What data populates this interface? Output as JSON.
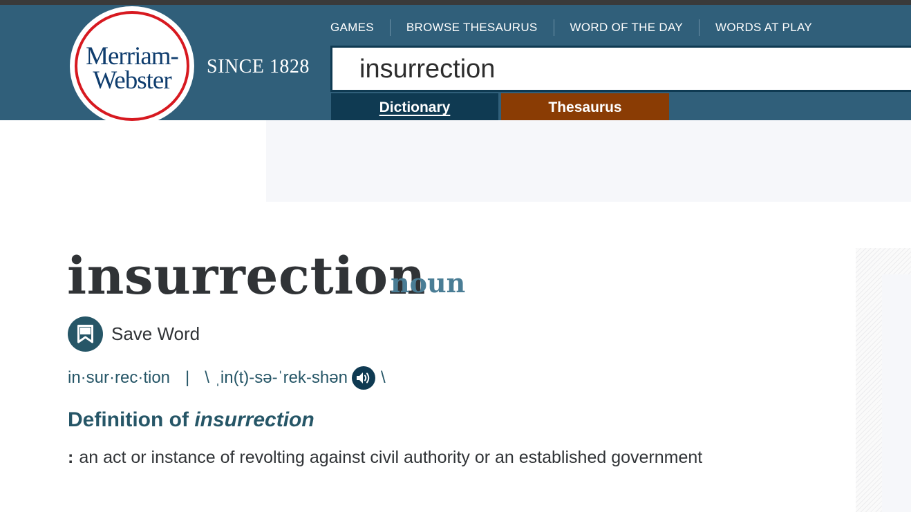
{
  "logo": {
    "line1": "Merriam-",
    "line2": "Webster"
  },
  "tagline": "SINCE 1828",
  "nav": [
    {
      "label": "GAMES"
    },
    {
      "label": "BROWSE THESAURUS"
    },
    {
      "label": "WORD OF THE DAY"
    },
    {
      "label": "WORDS AT PLAY"
    }
  ],
  "search": {
    "value": "insurrection"
  },
  "tabs": {
    "dictionary": "Dictionary",
    "thesaurus": "Thesaurus"
  },
  "entry": {
    "headword": "insurrection",
    "part_of_speech": "noun",
    "save_label": "Save Word",
    "syllables": "in·sur·rec·tion",
    "separator": "|",
    "slash_open": "\\",
    "pronunciation": "ˌin(t)-sə-ˈrek-shən",
    "slash_close": "\\",
    "definition_heading_prefix": "Definition of",
    "definition_heading_word": "insurrection",
    "definition_marker": ":",
    "definition": "an act or instance of revolting against civil authority or an established government"
  },
  "colors": {
    "header_bg": "#305f7a",
    "dictionary_tab": "#0f3a52",
    "thesaurus_tab": "#8a3c04",
    "logo_ring": "#d71920",
    "accent_text": "#265667"
  },
  "icons": {
    "save": "bookmark-icon",
    "audio": "speaker-icon"
  }
}
